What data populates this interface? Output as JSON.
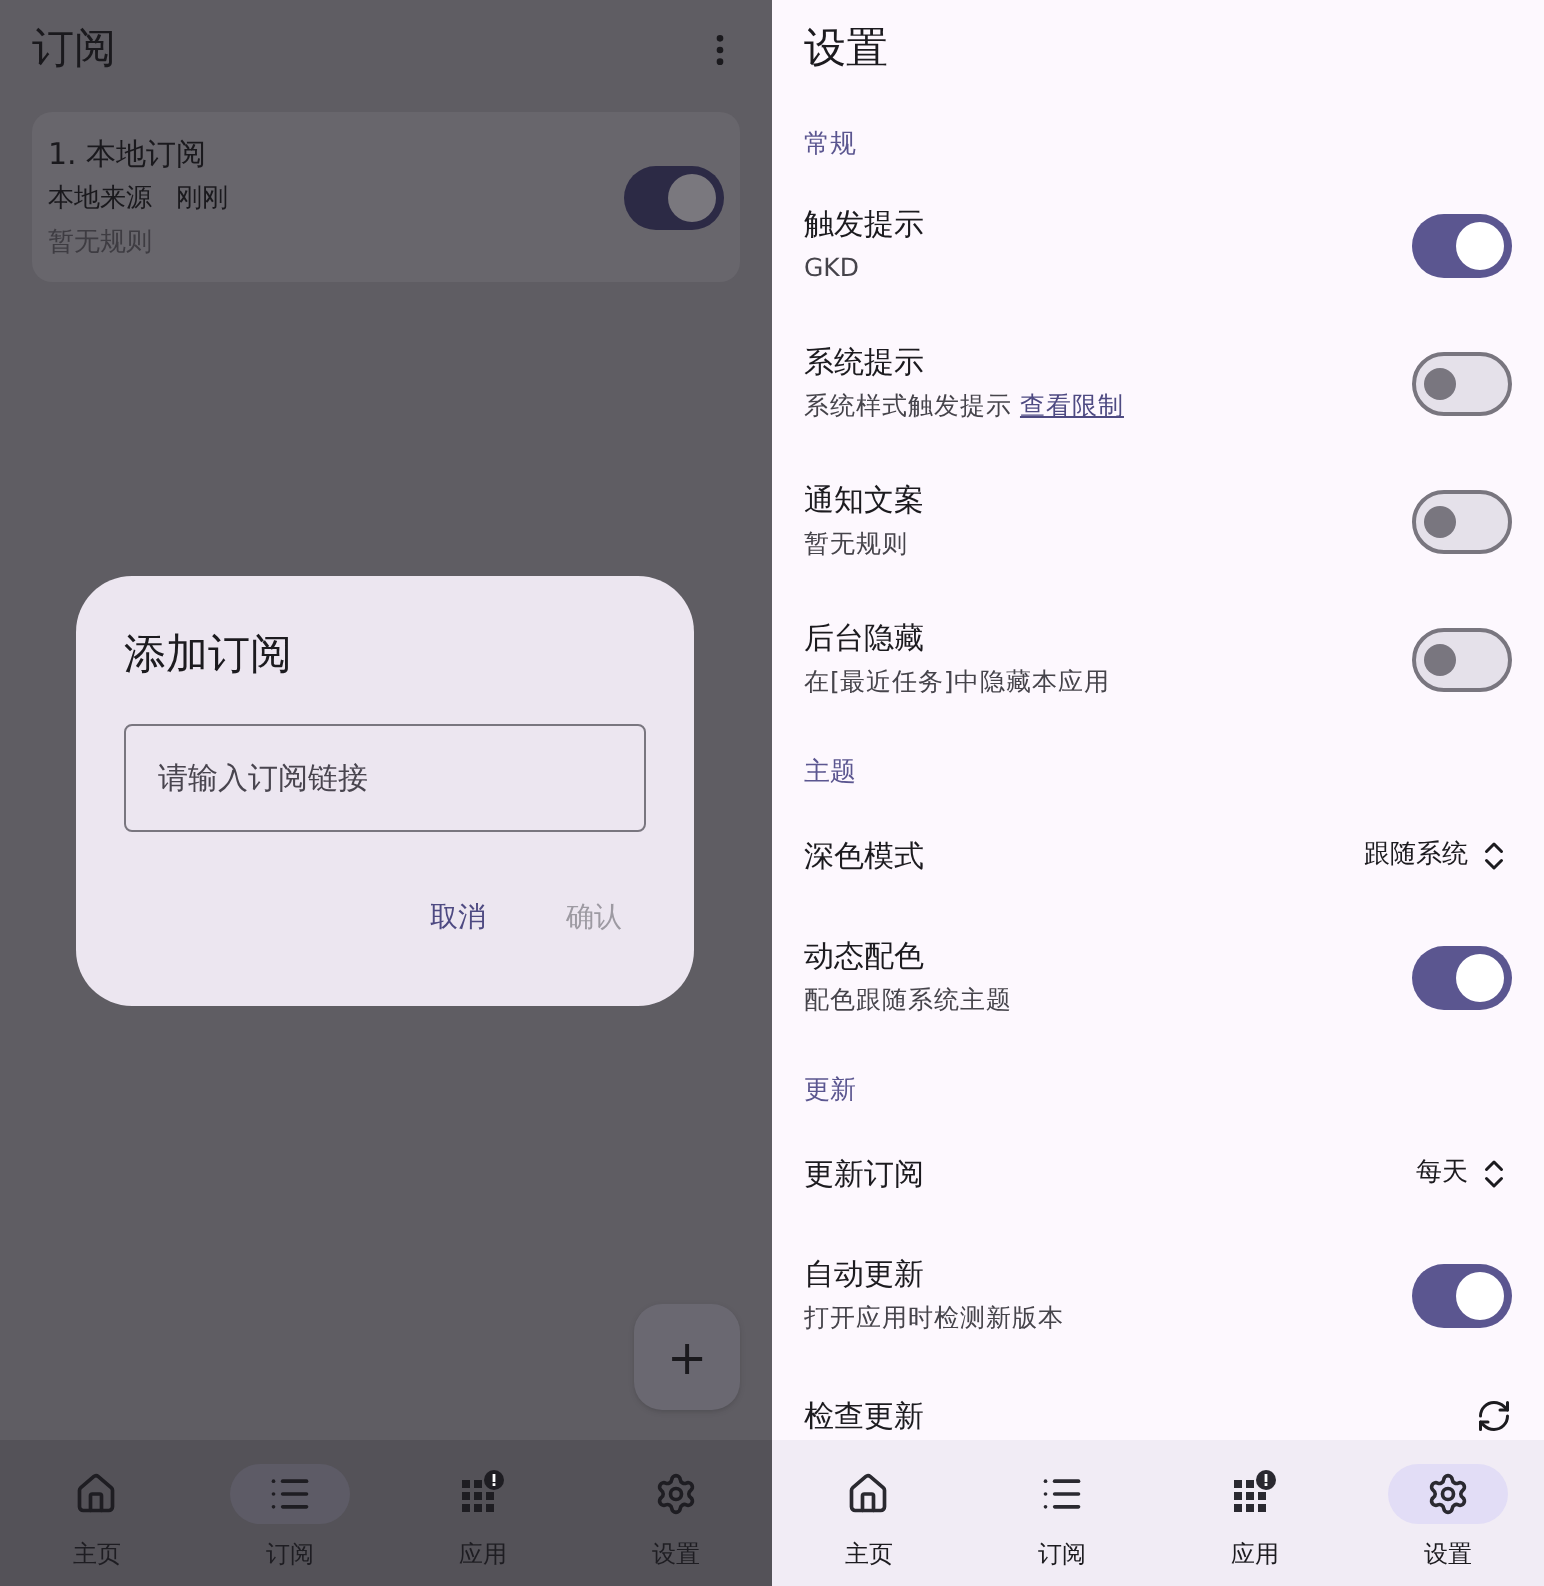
{
  "left": {
    "title": "订阅",
    "card": {
      "title": "1. 本地订阅",
      "source": "本地来源",
      "time": "刚刚",
      "note": "暂无规则",
      "on": true
    },
    "dialog": {
      "title": "添加订阅",
      "placeholder": "请输入订阅链接",
      "buttons": [
        {
          "label": "取消",
          "disabled": false
        },
        {
          "label": "确认",
          "disabled": true
        }
      ]
    },
    "fab": {
      "label": "+"
    },
    "nav": [
      {
        "label": "主页",
        "kind": "home",
        "selected": false
      },
      {
        "label": "订阅",
        "kind": "list",
        "selected": true
      },
      {
        "label": "应用",
        "kind": "apps",
        "selected": false
      },
      {
        "label": "设置",
        "kind": "gear",
        "selected": false
      }
    ]
  },
  "right": {
    "title": "设置",
    "sections": [
      {
        "header": "常规",
        "items": [
          {
            "kind": "switch",
            "title": "触发提示",
            "subtitle": "GKD",
            "on": true
          },
          {
            "kind": "switch",
            "title": "系统提示",
            "subtitle": "系统样式触发提示",
            "link": "查看限制",
            "on": false
          },
          {
            "kind": "switch",
            "title": "通知文案",
            "subtitle": "暂无规则",
            "on": false
          },
          {
            "kind": "switch",
            "title": "后台隐藏",
            "subtitle": "在[最近任务]中隐藏本应用",
            "on": false
          }
        ]
      },
      {
        "header": "主题",
        "items": [
          {
            "kind": "select",
            "title": "深色模式",
            "value": "跟随系统"
          },
          {
            "kind": "switch",
            "title": "动态配色",
            "subtitle": "配色跟随系统主题",
            "on": true
          }
        ]
      },
      {
        "header": "更新",
        "items": [
          {
            "kind": "select",
            "title": "更新订阅",
            "value": "每天"
          },
          {
            "kind": "switch",
            "title": "自动更新",
            "subtitle": "打开应用时检测新版本",
            "on": true
          },
          {
            "kind": "action",
            "title": "检查更新"
          }
        ]
      }
    ],
    "nav": [
      {
        "label": "主页",
        "kind": "home",
        "selected": false
      },
      {
        "label": "订阅",
        "kind": "list",
        "selected": false
      },
      {
        "label": "应用",
        "kind": "apps",
        "selected": false
      },
      {
        "label": "设置",
        "kind": "gear",
        "selected": true
      }
    ]
  }
}
